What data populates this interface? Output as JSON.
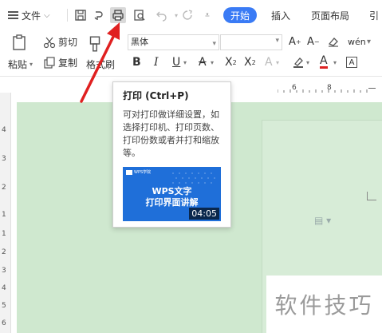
{
  "menu": {
    "label": "文件"
  },
  "tabs": [
    {
      "label": "开始",
      "active": true
    },
    {
      "label": "插入",
      "active": false
    },
    {
      "label": "页面布局",
      "active": false
    },
    {
      "label": "引",
      "active": false
    }
  ],
  "quick_access": [
    "save-icon",
    "format-painter-icon",
    "print-icon",
    "print-preview-icon",
    "undo-icon",
    "redo-icon",
    "dropdown-icon"
  ],
  "ribbon": {
    "cut_label": "剪切",
    "paste_label": "粘贴",
    "copy_label": "复制",
    "format_brush_label": "格式刷",
    "font_name": "黑体",
    "font_size": "",
    "pinyin_label": "wén"
  },
  "ruler": {
    "h_label_1": "6",
    "h_label_2": "8",
    "v_labels": [
      "4",
      "3",
      "2",
      "1",
      "1",
      "2",
      "3",
      "4",
      "5",
      "6"
    ]
  },
  "tooltip": {
    "title": "打印 (Ctrl+P)",
    "desc": "可对打印做详细设置，如选择打印机、打印页数、打印份数或者并打和缩放等。",
    "video_brand": "WPS学院",
    "video_line1": "WPS文字",
    "video_line2": "打印界面讲解",
    "video_duration": "04:05"
  },
  "watermark": "软件技巧",
  "colors": {
    "accent": "#3a7bf5",
    "arrow": "#e02020",
    "canvas": "#cfe8cf"
  }
}
